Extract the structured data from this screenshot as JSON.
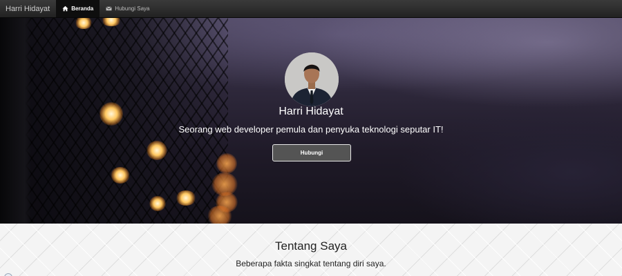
{
  "navbar": {
    "brand": "Harri Hidayat",
    "items": [
      {
        "label": "Beranda",
        "icon": "home-icon",
        "active": true
      },
      {
        "label": "Hubungi Saya",
        "icon": "envelope-icon",
        "active": false
      }
    ]
  },
  "hero": {
    "name": "Harri Hidayat",
    "tagline": "Seorang web developer pemula dan penyuka teknologi seputar IT!",
    "button_label": "Hubungi"
  },
  "about": {
    "title": "Tentang Saya",
    "subtitle": "Beberapa fakta singkat tentang diri saya."
  },
  "colors": {
    "navbar_bg": "#222222",
    "hero_dark": "#1f1a28",
    "button_bg": "#545454",
    "about_bg": "#f4f4f4"
  }
}
